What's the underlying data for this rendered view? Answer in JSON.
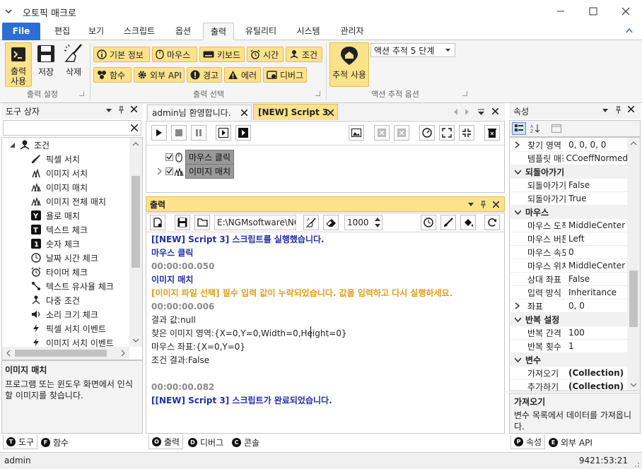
{
  "window": {
    "title": "오토픽 매크로"
  },
  "menu_tabs": [
    "File",
    "편집",
    "보기",
    "스크립트",
    "옵션",
    "출력",
    "유틸리티",
    "시스템",
    "관리자"
  ],
  "ribbon": {
    "output_settings": {
      "print": "출력\n사용",
      "save": "저장",
      "delete": "삭제",
      "label": "출력 설정"
    },
    "output_select": {
      "buttons": [
        "기본 정보",
        "마우스",
        "키보드",
        "시간",
        "조건",
        "함수",
        "외부 API",
        "경고",
        "에러",
        "디버그"
      ],
      "label": "출력 선택"
    },
    "action_tracking": {
      "button": "추적 사용",
      "dropdown": "액션 추적 5 단계",
      "label": "액션 추적 옵션"
    }
  },
  "toolbox": {
    "title": "도구 상자",
    "search_placeholder": "",
    "category": "조건",
    "items": [
      "픽셀 서치",
      "이미지 서치",
      "이미지 매치",
      "이미지 전체 매치",
      "욜로 매치",
      "텍스트 체크",
      "숫자 체크",
      "날짜 시간 체크",
      "타이머 체크",
      "텍스트 유사율 체크",
      "다중 조건",
      "소리 크기 체크",
      "픽셀 서치 이벤트",
      "이미지 서치 이벤트"
    ],
    "desc_title": "이미지 매치",
    "desc_text": "프로그램 또는 윈도우 화면에서 인식할 이미지를 찾습니다.",
    "tabs": [
      "도구",
      "함수"
    ]
  },
  "editor": {
    "tabs": [
      "admin님 환영합니다.",
      "[NEW] Script 3"
    ],
    "nodes": [
      "마우스 클릭",
      "이미지 매치"
    ]
  },
  "output": {
    "title": "출력",
    "path": "E:\\NGMsoftware\\NG",
    "spin_value": "1000",
    "lines": [
      {
        "text": "[[NEW] Script 3] 스크립트를 실행했습니다.",
        "color": "#1f2fa8",
        "bold": true
      },
      {
        "text": "마우스 클릭",
        "color": "#1f2fa8",
        "bold": true
      },
      {
        "text": "00:00:00.050",
        "color": "#8a8a8a",
        "bold": true
      },
      {
        "text": "이미지 매치",
        "color": "#1f2fa8",
        "bold": true
      },
      {
        "text": "[이미지 파일 선택] 필수 입력 값이 누락되었습니다. 값을 입력하고 다시 실행하세요.",
        "color": "#e49b1b",
        "bold": true
      },
      {
        "text": "00:00:00.006",
        "color": "#8a8a8a",
        "bold": true
      },
      {
        "text": "결과 값:null",
        "color": "#222",
        "bold": false
      },
      {
        "text": "찾은 이미지 영역:{X=0,Y=0,Width=0,Height=0}",
        "color": "#222",
        "bold": false
      },
      {
        "text": "마우스 좌표:{X=0,Y=0}",
        "color": "#222",
        "bold": false
      },
      {
        "text": "조건 결과:False",
        "color": "#222",
        "bold": false
      },
      {
        "text": "",
        "color": "#222",
        "bold": false
      },
      {
        "text": "00:00:00.082",
        "color": "#8a8a8a",
        "bold": true
      },
      {
        "text": "[[NEW] Script 3] 스크립트가 완료되었습니다.",
        "color": "#1f2fa8",
        "bold": true
      }
    ],
    "tabs": [
      "출력",
      "디버그",
      "콘솔"
    ]
  },
  "properties": {
    "title": "속성",
    "rows": [
      {
        "type": "row",
        "name": "찾기 영역",
        "value": "0, 0, 0, 0",
        "expand": true
      },
      {
        "type": "row",
        "name": "템플릿 매칭",
        "value": "CCoeffNormed"
      },
      {
        "type": "cat",
        "name": "되돌아가기"
      },
      {
        "type": "row",
        "name": "되돌아가기",
        "value": "False"
      },
      {
        "type": "row",
        "name": "되돌아가기",
        "value": "True"
      },
      {
        "type": "cat",
        "name": "마우스"
      },
      {
        "type": "row",
        "name": "마우스 도착",
        "value": "MiddleCenter"
      },
      {
        "type": "row",
        "name": "마우스 버튼",
        "value": "Left"
      },
      {
        "type": "row",
        "name": "마우스 속도",
        "value": "0"
      },
      {
        "type": "row",
        "name": "마우스 위치",
        "value": "MiddleCenter"
      },
      {
        "type": "row",
        "name": "상대 좌표",
        "value": "False"
      },
      {
        "type": "row",
        "name": "입력 방식",
        "value": "Inheritance"
      },
      {
        "type": "row",
        "name": "좌표",
        "value": "0, 0",
        "expand": true
      },
      {
        "type": "cat",
        "name": "반복 설정"
      },
      {
        "type": "row",
        "name": "반복 간격",
        "value": "100"
      },
      {
        "type": "row",
        "name": "반복 횟수",
        "value": "1"
      },
      {
        "type": "cat",
        "name": "변수"
      },
      {
        "type": "row",
        "name": "가져오기",
        "value": "(Collection)",
        "bold": true
      },
      {
        "type": "row",
        "name": "추가하기",
        "value": "(Collection)",
        "bold": true
      }
    ],
    "desc_title": "가져오기",
    "desc_text": "변수 목록에서 데이터를 가져옵니다.",
    "tabs": [
      "속성",
      "외부 API"
    ]
  },
  "status": {
    "user": "admin",
    "time": "9421:53:21"
  }
}
